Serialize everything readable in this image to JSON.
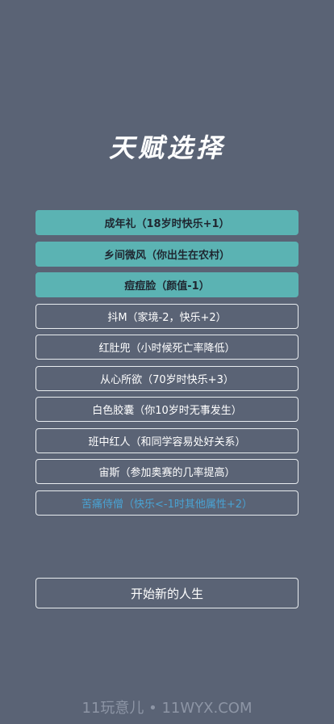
{
  "title": "天赋选择",
  "talents": [
    {
      "label": "成年礼（18岁时快乐+1）",
      "state": "selected"
    },
    {
      "label": "乡间微风（你出生在农村）",
      "state": "selected"
    },
    {
      "label": "痘痘脸（颜值-1）",
      "state": "selected"
    },
    {
      "label": "抖M（家境-2，快乐+2）",
      "state": "normal"
    },
    {
      "label": "红肚兜（小时候死亡率降低）",
      "state": "normal"
    },
    {
      "label": "从心所欲（70岁时快乐+3）",
      "state": "normal"
    },
    {
      "label": "白色胶囊（你10岁时无事发生）",
      "state": "normal"
    },
    {
      "label": "班中红人（和同学容易处好关系）",
      "state": "normal"
    },
    {
      "label": "宙斯（参加奥赛的几率提高）",
      "state": "normal"
    },
    {
      "label": "苦痛侍僧（快乐<-1时其他属性+2）",
      "state": "rare"
    }
  ],
  "start_button": "开始新的人生",
  "watermark": "11玩意儿 • 11WYX.COM",
  "colors": {
    "background": "#5a6375",
    "selected": "#5bb3b3",
    "rare_text": "#49a3d4"
  }
}
